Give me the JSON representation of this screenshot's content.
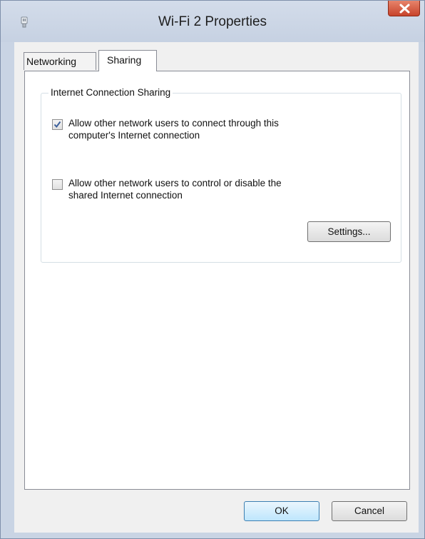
{
  "window": {
    "title": "Wi-Fi 2 Properties",
    "icon": "network-adapter-icon"
  },
  "tabs": [
    {
      "label": "Networking",
      "active": false
    },
    {
      "label": "Sharing",
      "active": true
    }
  ],
  "sharing": {
    "group_title": "Internet Connection Sharing",
    "options": [
      {
        "label_line1": "Allow other network users to connect through this",
        "label_line2": "computer's Internet connection",
        "checked": true
      },
      {
        "label_line1": "Allow other network users to control or disable the",
        "label_line2": "shared Internet connection",
        "checked": false
      }
    ],
    "settings_button": "Settings..."
  },
  "footer": {
    "ok_label": "OK",
    "cancel_label": "Cancel"
  },
  "colors": {
    "close_button": "#c7432b",
    "frame": "#c9d4e4",
    "check_mark": "#3b5f9b"
  }
}
